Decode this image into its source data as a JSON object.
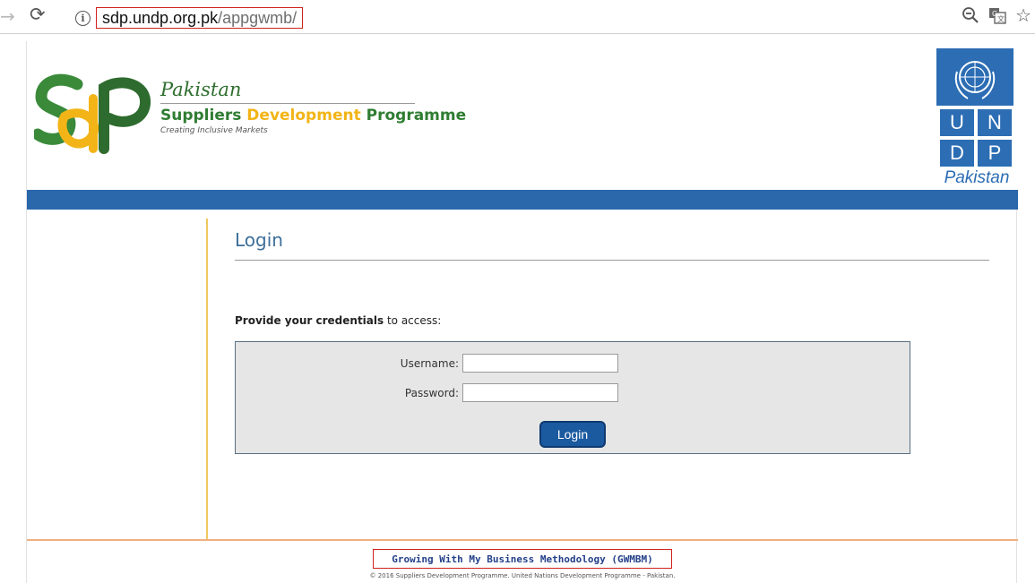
{
  "browser": {
    "url_host": "sdp.undp.org.pk",
    "url_path": "/appgwmb/"
  },
  "header": {
    "country": "Pakistan",
    "brand_suppliers": "Suppliers ",
    "brand_development": "Development",
    "brand_programme": " Programme",
    "tagline": "Creating Inclusive Markets",
    "undp_letters": [
      "U",
      "N",
      "D",
      "P"
    ],
    "undp_country": "Pakistan"
  },
  "main": {
    "title": "Login",
    "credentials_bold": "Provide your credentials",
    "credentials_rest": " to access:",
    "form": {
      "username_label": "Username:",
      "username_value": "",
      "password_label": "Password:",
      "password_value": "",
      "login_button": "Login"
    }
  },
  "footer": {
    "link_text": "Growing With My Business Methodology (GWMBM)",
    "copyright": "© 2016 Suppliers Development Programme. United Nations Development Programme - Pakistan."
  },
  "colors": {
    "brand_blue": "#2a67ab",
    "brand_green": "#2f7d32",
    "brand_yellow": "#f2b416",
    "highlight_red": "#d0201a"
  }
}
